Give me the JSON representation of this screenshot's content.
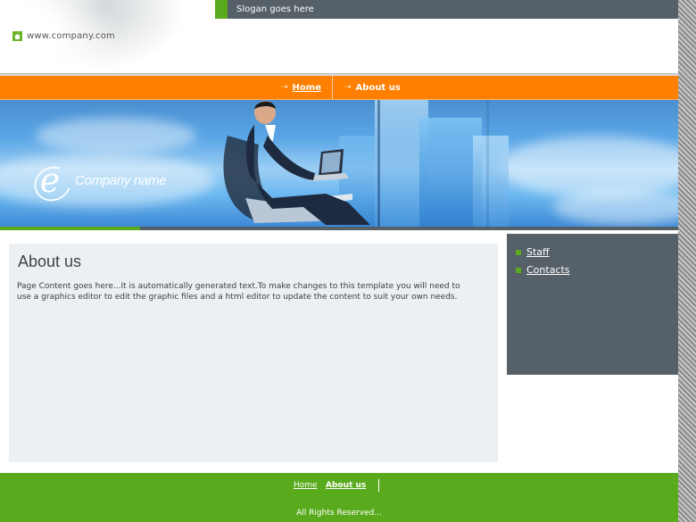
{
  "header": {
    "url_text": "www.company.com",
    "slogan": "Slogan goes here"
  },
  "nav": {
    "items": [
      {
        "label": "Home",
        "active": true
      },
      {
        "label": "About us",
        "active": false
      }
    ]
  },
  "banner": {
    "company_name": "Company name",
    "logo_letter": "e"
  },
  "main": {
    "title": "About us",
    "body": "Page Content goes here...It is automatically generated text.To make changes to this template you will need to use a graphics editor to edit the graphic files and a html editor to update the content to suit your own needs."
  },
  "sidebar": {
    "items": [
      {
        "label": "Staff"
      },
      {
        "label": "Contacts"
      }
    ]
  },
  "footer": {
    "links": [
      {
        "label": "Home"
      },
      {
        "label": "About us"
      }
    ],
    "copyright": "All Rights Reserved..."
  },
  "colors": {
    "nav_orange": "#ff7f00",
    "accent_green": "#5aaa1e",
    "slate": "#566068",
    "content_bg": "#ecf0f2"
  }
}
